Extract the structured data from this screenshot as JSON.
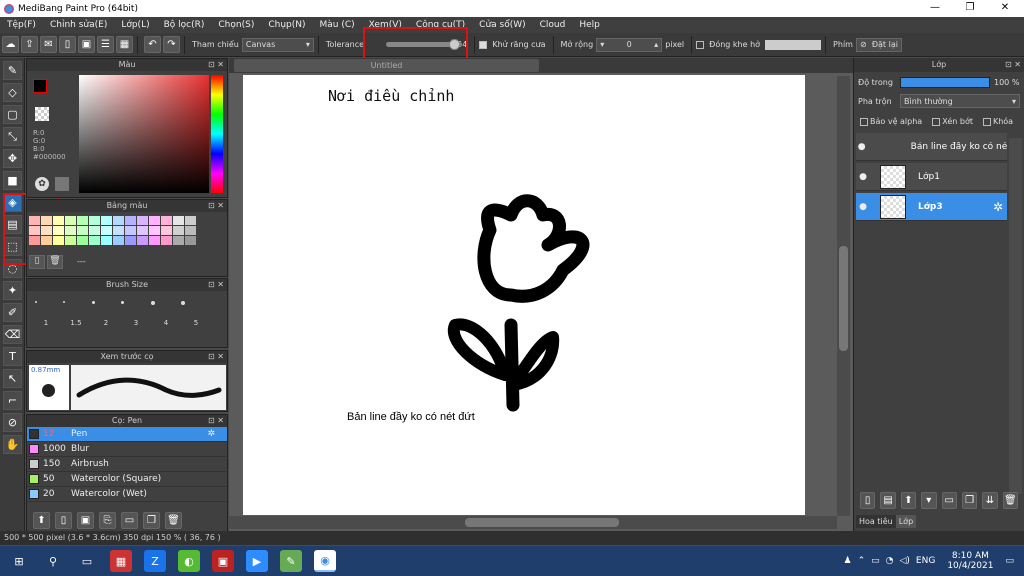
{
  "window": {
    "title": "MediBang Paint Pro (64bit)"
  },
  "menu": [
    "Tệp(F)",
    "Chỉnh sửa(E)",
    "Lớp(L)",
    "Bộ lọc(R)",
    "Chọn(S)",
    "Chụp(N)",
    "Màu (C)",
    "Xem(V)",
    "Công cụ(T)",
    "Cửa sổ(W)",
    "Cloud",
    "Help"
  ],
  "toolbar": {
    "reference_label": "Tham chiếu",
    "reference_value": "Canvas",
    "tolerance_label": "Tolerance",
    "tolerance_value": "254",
    "antialias_label": "Khử răng cưa",
    "expand_label": "Mở rộng",
    "expand_value": "0",
    "expand_unit": "pixel",
    "close_gap_label": "Đóng khe hở",
    "keys_label": "Phím",
    "reset_label": "Đặt lại"
  },
  "color_panel": {
    "title": "Màu",
    "r": "R:0",
    "g": "G:0",
    "b": "B:0",
    "hex": "#000000",
    "primary": "#000000",
    "secondary": "#cc66ff"
  },
  "palette_panel": {
    "title": "Bảng màu",
    "footer": "---",
    "swatches": [
      "#ffb3b3",
      "#ffd9b3",
      "#ffffb3",
      "#d9ffb3",
      "#b3ffb3",
      "#b3ffd9",
      "#b3ffff",
      "#b3d9ff",
      "#b3b3ff",
      "#d9b3ff",
      "#ffb3ff",
      "#ffb3d9",
      "#e6e6e6",
      "#cccccc",
      "#ffc6c6",
      "#ffe0c6",
      "#ffffc6",
      "#e0ffc6",
      "#c6ffc6",
      "#c6ffe0",
      "#c6ffff",
      "#c6e0ff",
      "#c6c6ff",
      "#e0c6ff",
      "#ffc6ff",
      "#ffc6e0",
      "#d0d0d0",
      "#bbbbbb",
      "#ff9999",
      "#ffcc99",
      "#ffff99",
      "#ccff99",
      "#99ff99",
      "#99ffcc",
      "#99ffff",
      "#99ccff",
      "#9999ff",
      "#cc99ff",
      "#ff99ff",
      "#ff99cc",
      "#aaaaaa",
      "#999999"
    ]
  },
  "brush_size_panel": {
    "title": "Brush Size",
    "sizes": [
      "1",
      "1.5",
      "2",
      "3",
      "4",
      "5"
    ]
  },
  "brush_preview_panel": {
    "title": "Xem trước cọ",
    "size": "0.87mm"
  },
  "brush_list_panel": {
    "title": "Cọ: Pen",
    "items": [
      {
        "num": "12",
        "name": "Pen",
        "color": "#333333"
      },
      {
        "num": "1000",
        "name": "Blur",
        "color": "#ff88ff"
      },
      {
        "num": "150",
        "name": "Airbrush",
        "color": "#cccccc"
      },
      {
        "num": "50",
        "name": "Watercolor (Square)",
        "color": "#aaee66"
      },
      {
        "num": "20",
        "name": "Watercolor (Wet)",
        "color": "#88ccff"
      }
    ]
  },
  "canvas": {
    "tab_title": "Untitled",
    "heading": "Nơi điều chỉnh",
    "note": "Bản line đầy ko có nét đứt"
  },
  "layer_panel": {
    "title": "Lớp",
    "opacity_label": "Độ trong",
    "opacity_value": "100 %",
    "opacity": 1.0,
    "blend_label": "Pha trộn",
    "blend_value": "Bình thường",
    "protect_alpha": "Bảo vệ alpha",
    "clipping": "Xén bớt",
    "lock": "Khóa",
    "layers": [
      {
        "name": "Bản line đầy ko có nét đứt"
      },
      {
        "name": "Lớp1"
      },
      {
        "name": "Lớp3"
      }
    ],
    "tab_navigator": "Hoa tiêu",
    "tab_layer": "Lớp"
  },
  "status": {
    "text": "500 * 500 pixel  (3.6 * 3.6cm)  350 dpi  150 %  ( 36, 76 )"
  },
  "taskbar": {
    "lang": "ENG",
    "time": "8:10 AM",
    "date": "10/4/2021"
  }
}
